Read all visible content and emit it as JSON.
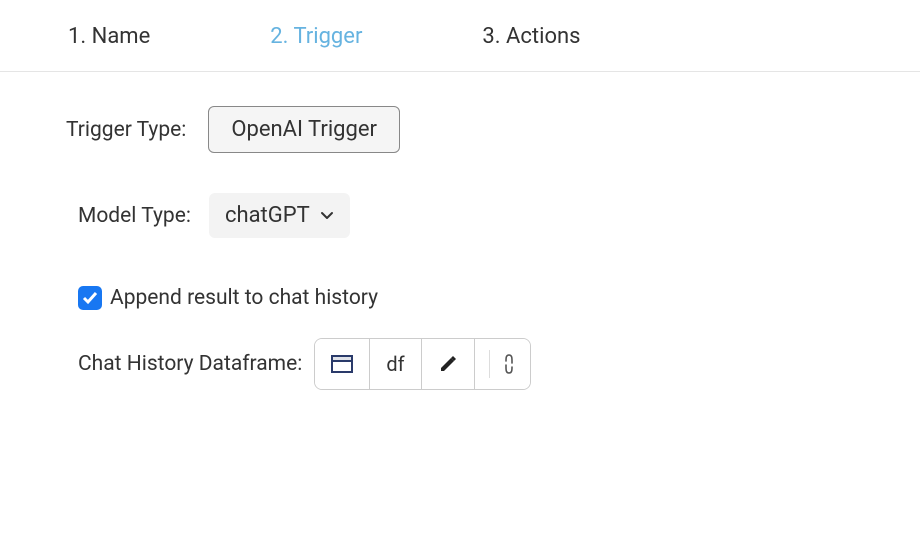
{
  "tabs": {
    "name": "1. Name",
    "trigger": "2. Trigger",
    "actions": "3. Actions"
  },
  "triggerType": {
    "label": "Trigger Type:",
    "value": "OpenAI Trigger"
  },
  "modelType": {
    "label": "Model Type:",
    "value": "chatGPT"
  },
  "appendHistory": {
    "label": "Append result to chat history",
    "checked": true
  },
  "dataframe": {
    "label": "Chat History Dataframe:",
    "value": "df"
  }
}
